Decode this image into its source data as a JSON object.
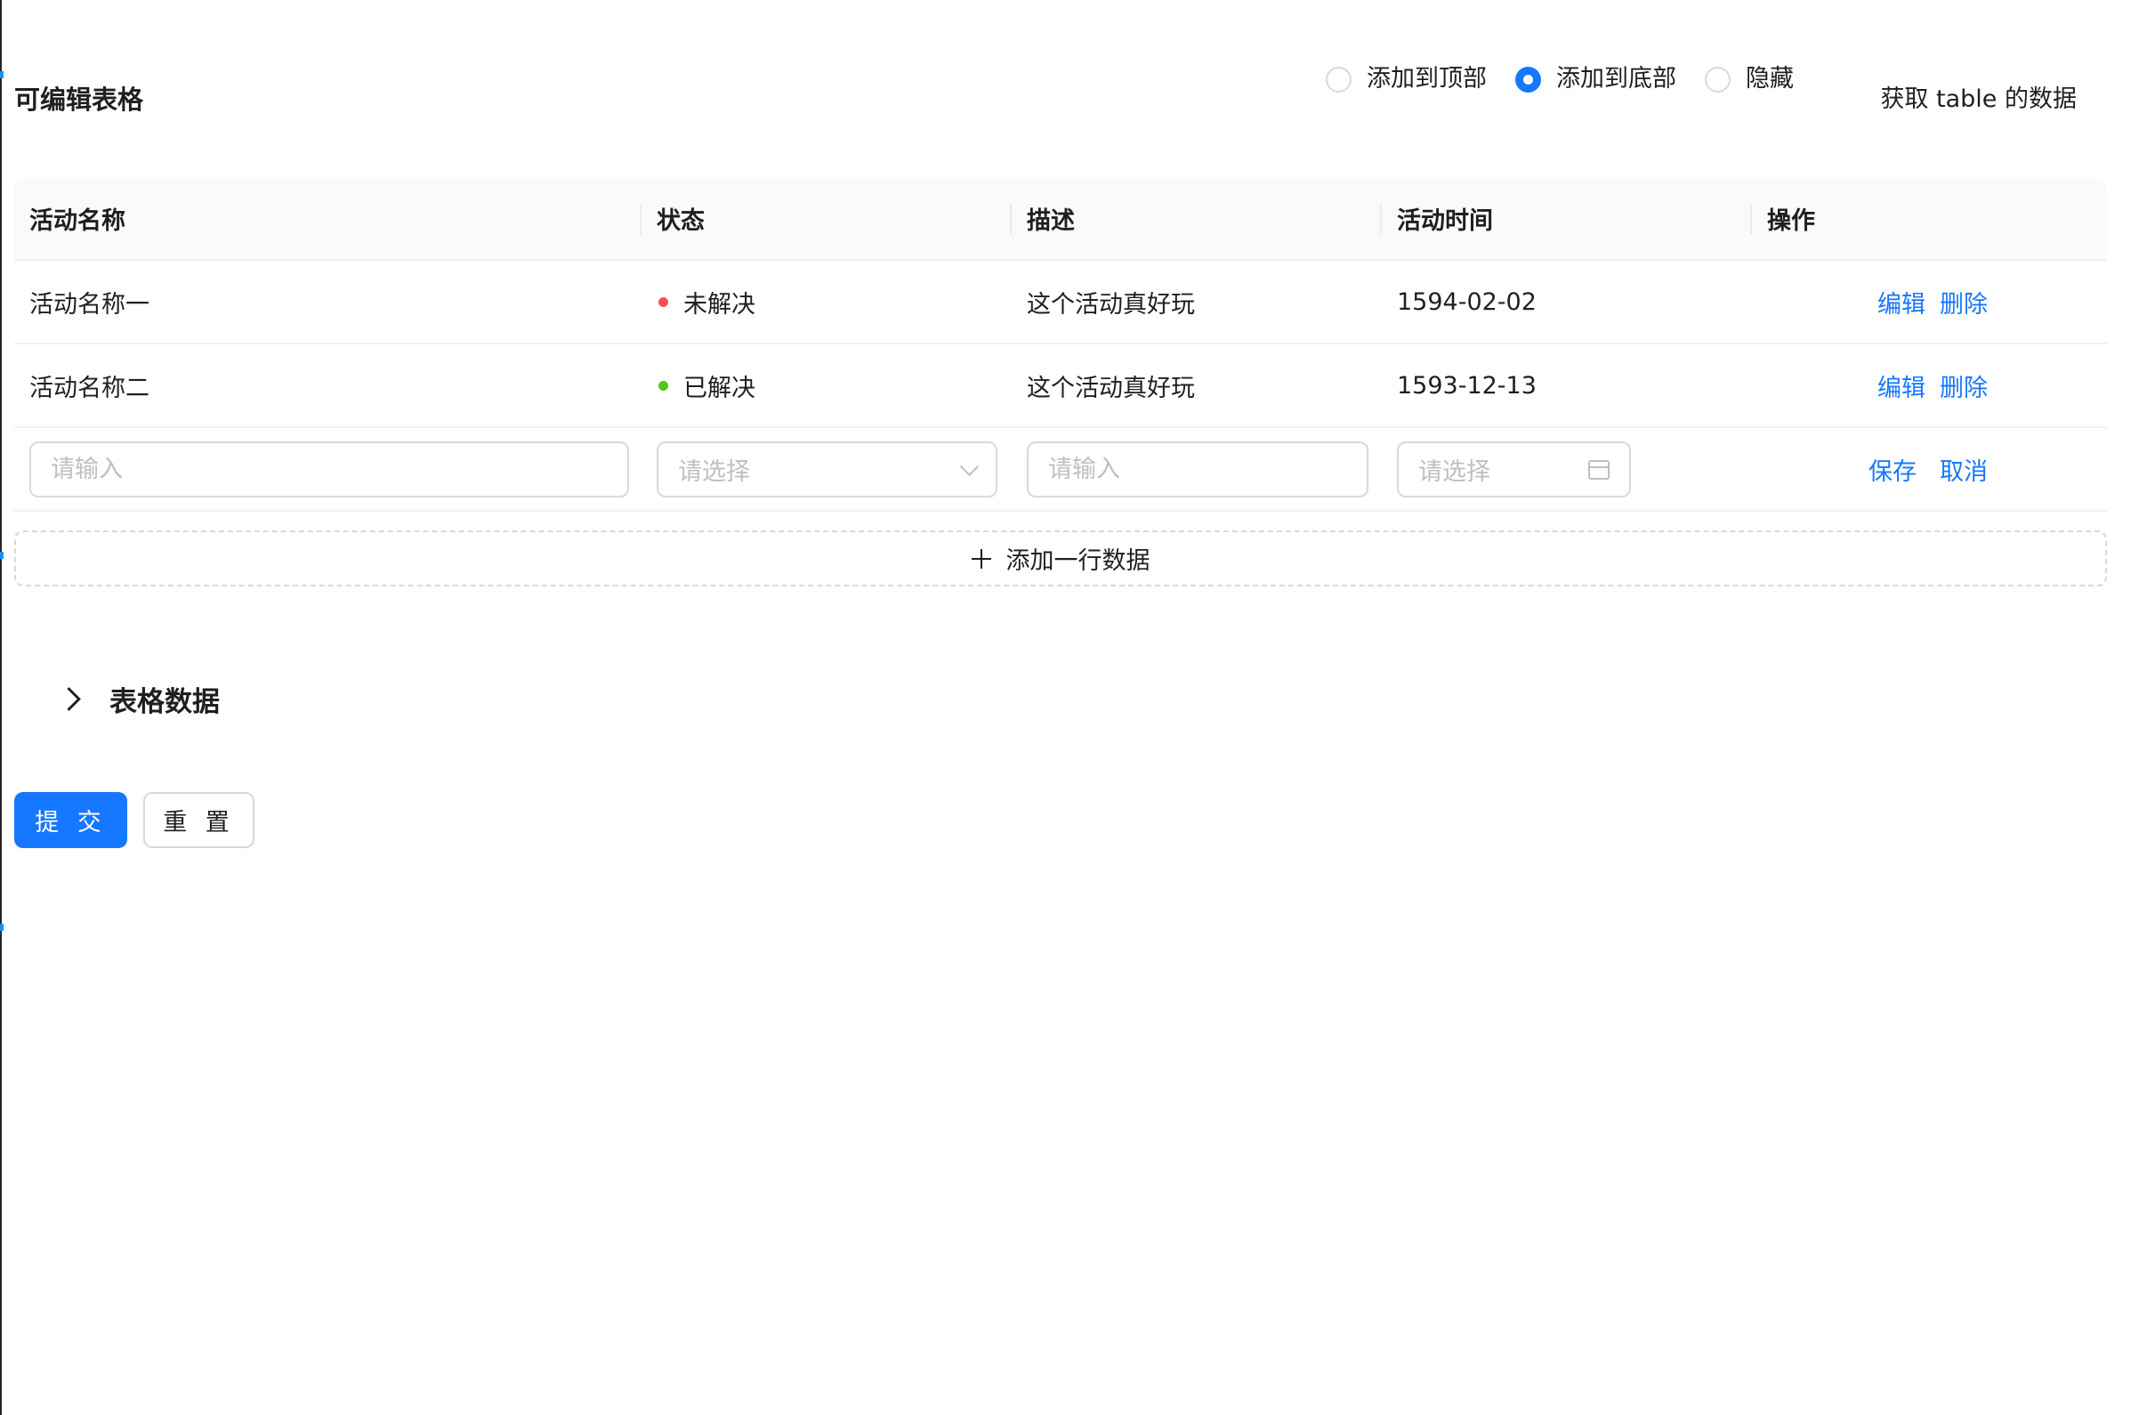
{
  "toolbar": {
    "title": "可编辑表格",
    "position_options": [
      {
        "label": "添加到顶部",
        "checked": false
      },
      {
        "label": "添加到底部",
        "checked": true
      },
      {
        "label": "隐藏",
        "checked": false
      }
    ],
    "get_data_label": "获取 table 的数据"
  },
  "table": {
    "columns": [
      "活动名称",
      "状态",
      "描述",
      "活动时间",
      "操作"
    ],
    "rows": [
      {
        "name": "活动名称一",
        "status": "未解决",
        "status_color": "#ff4d4f",
        "desc": "这个活动真好玩",
        "date": "1594-02-02",
        "edit": "编辑",
        "delete": "删除"
      },
      {
        "name": "活动名称二",
        "status": "已解决",
        "status_color": "#52c41a",
        "desc": "这个活动真好玩",
        "date": "1593-12-13",
        "edit": "编辑",
        "delete": "删除"
      }
    ],
    "edit_row": {
      "name_placeholder": "请输入",
      "status_placeholder": "请选择",
      "desc_placeholder": "请输入",
      "date_placeholder": "请选择",
      "save": "保存",
      "cancel": "取消"
    }
  },
  "add_row_label": "添加一行数据",
  "collapse": {
    "title": "表格数据",
    "expanded": false
  },
  "form_actions": {
    "submit": "提 交",
    "reset": "重 置"
  },
  "colors": {
    "primary": "#1677ff"
  }
}
